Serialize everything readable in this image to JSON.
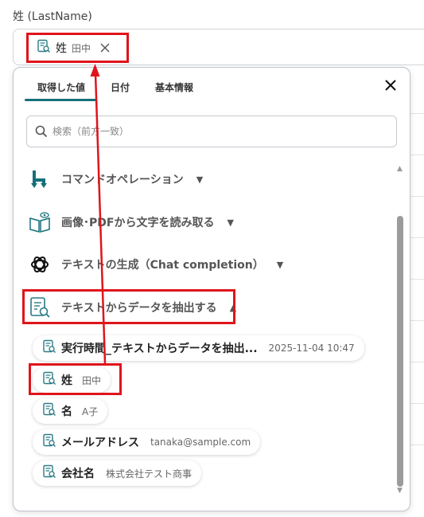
{
  "field": {
    "label": "姓 (LastName)"
  },
  "field_chip": {
    "name": "姓",
    "value": "田中"
  },
  "panel": {
    "tabs": [
      "取得した値",
      "日付",
      "基本情報"
    ],
    "search_placeholder": "検索（前方一致）",
    "categories": [
      {
        "label": "コマンドオペレーション",
        "icon": "yoom-command-icon"
      },
      {
        "label": "画像･PDFから文字を読み取る",
        "icon": "ocr-book-icon"
      },
      {
        "label": "テキストの生成（Chat completion）",
        "icon": "openai-icon"
      },
      {
        "label": "テキストからデータを抽出する",
        "icon": "extract-doc-icon"
      }
    ],
    "items": [
      {
        "name": "実行時間_テキストからデータを抽出...",
        "value": "2025-11-04 10:47"
      },
      {
        "name": "姓",
        "value": "田中"
      },
      {
        "name": "名",
        "value": "A子"
      },
      {
        "name": "メールアドレス",
        "value": "tanaka@sample.com"
      },
      {
        "name": "会社名",
        "value": "株式会社テスト商事"
      }
    ]
  },
  "colors": {
    "accent": "#16707b",
    "highlight": "#e0141b",
    "chip_icon": "#2a7a85"
  }
}
